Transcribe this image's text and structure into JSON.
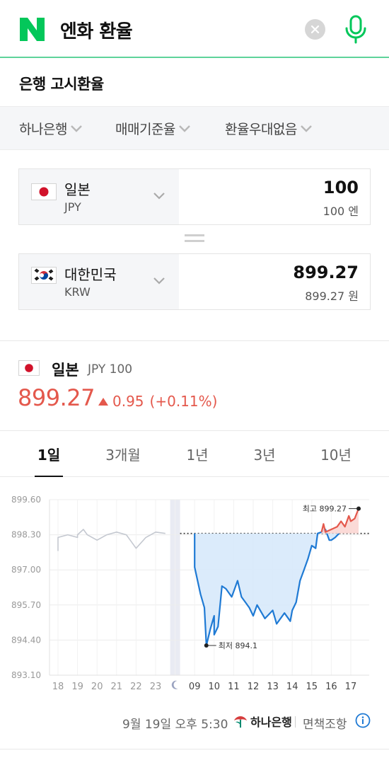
{
  "search": {
    "query": "엔화 환율",
    "logo_letter": "N",
    "logo_icon": "naver-logo-icon",
    "clear_icon": "clear-icon",
    "mic_icon": "microphone-icon",
    "accent_color": "#03c75a"
  },
  "section_title": "은행 고시환율",
  "filters": [
    {
      "label": "하나은행"
    },
    {
      "label": "매매기준율"
    },
    {
      "label": "환율우대없음"
    }
  ],
  "converter": {
    "from": {
      "name": "일본",
      "code": "JPY",
      "amount": "100",
      "amount_text": "100 엔",
      "flag_icon": "japan-flag-icon"
    },
    "to": {
      "name": "대한민국",
      "code": "KRW",
      "amount": "899.27",
      "amount_text": "899.27 원",
      "flag_icon": "korea-flag-icon"
    }
  },
  "rate": {
    "country": "일본",
    "code": "JPY 100",
    "value": "899.27",
    "change": "0.95",
    "change_pct": "(+0.11%)",
    "direction": "up",
    "up_color": "#e4584c"
  },
  "tabs": [
    {
      "label": "1일",
      "active": true
    },
    {
      "label": "3개월",
      "active": false
    },
    {
      "label": "1년",
      "active": false
    },
    {
      "label": "3년",
      "active": false
    },
    {
      "label": "10년",
      "active": false
    }
  ],
  "chart_data": {
    "type": "line",
    "y_ticks": [
      "899.60",
      "898.30",
      "897.00",
      "895.70",
      "894.40",
      "893.10"
    ],
    "ylim": [
      893.1,
      899.6
    ],
    "x_labels": [
      "18",
      "19",
      "20",
      "21",
      "22",
      "23",
      "moon-icon",
      "09",
      "10",
      "11",
      "12",
      "13",
      "14",
      "15",
      "16",
      "17"
    ],
    "grid": true,
    "baseline": 898.35,
    "max_label": "최고 899.27",
    "min_label": "최저 894.1",
    "series": [
      {
        "segment": "previous-days",
        "color": "#c4c8d0",
        "points": [
          [
            "18",
            897.7
          ],
          [
            "18",
            898.2
          ],
          [
            "18.5",
            898.3
          ],
          [
            "19",
            898.2
          ],
          [
            "19",
            898.3
          ],
          [
            "19.3",
            898.5
          ],
          [
            "19.5",
            898.3
          ],
          [
            "20",
            898.1
          ],
          [
            "20.5",
            898.3
          ],
          [
            "21",
            898.4
          ],
          [
            "21.5",
            898.3
          ],
          [
            "21.7",
            898.1
          ],
          [
            "22",
            897.8
          ],
          [
            "22.5",
            898.2
          ],
          [
            "23",
            898.4
          ],
          [
            "23.5",
            898.35
          ]
        ]
      },
      {
        "segment": "today-below-baseline",
        "color": "#1f7ad4",
        "points": [
          [
            "09",
            898.35
          ],
          [
            "09",
            897.3
          ],
          [
            "09",
            897.1
          ],
          [
            "09.3",
            896.1
          ],
          [
            "09.5",
            895.6
          ],
          [
            "09.6",
            894.2
          ],
          [
            "09.8",
            894.8
          ],
          [
            "10",
            895.3
          ],
          [
            "10",
            894.6
          ],
          [
            "10.2",
            894.9
          ],
          [
            "10.4",
            896.4
          ],
          [
            "10.6",
            896.3
          ],
          [
            "10.9",
            896.0
          ],
          [
            "11",
            896.2
          ],
          [
            "11.2",
            896.6
          ],
          [
            "11.4",
            896.0
          ],
          [
            "11.6",
            895.8
          ],
          [
            "11.8",
            895.6
          ],
          [
            "12",
            895.3
          ],
          [
            "12.2",
            895.7
          ],
          [
            "12.6",
            895.2
          ],
          [
            "13",
            895.5
          ],
          [
            "13.2",
            895.0
          ],
          [
            "13.6",
            895.4
          ],
          [
            "13.9",
            895.1
          ],
          [
            "14",
            895.5
          ],
          [
            "14.2",
            895.8
          ],
          [
            "14.4",
            896.6
          ],
          [
            "14.6",
            897.0
          ],
          [
            "14.8",
            897.4
          ],
          [
            "15",
            897.9
          ],
          [
            "15.2",
            897.8
          ],
          [
            "15.3",
            898.35
          ],
          [
            "15.5",
            898.4
          ],
          [
            "15.7",
            898.5
          ],
          [
            "15.9",
            898.1
          ],
          [
            "16",
            898.1
          ],
          [
            "16.2",
            898.2
          ],
          [
            "16.4",
            898.35
          ]
        ]
      },
      {
        "segment": "today-above-baseline",
        "color": "#e4584c",
        "points": [
          [
            "15.5",
            898.4
          ],
          [
            "15.6",
            898.7
          ],
          [
            "15.7",
            898.4
          ],
          [
            "16.3",
            898.6
          ],
          [
            "16.5",
            898.8
          ],
          [
            "16.7",
            898.6
          ],
          [
            "16.9",
            899.0
          ],
          [
            "17",
            898.8
          ],
          [
            "17.2",
            898.9
          ],
          [
            "17.4",
            899.27
          ]
        ]
      }
    ]
  },
  "footer": {
    "timestamp": "9월 19일 오후 5:30",
    "bank_name": "하나은행",
    "bank_icon": "hana-bank-logo-icon",
    "disclaimer": "면책조항",
    "info_icon": "info-icon"
  }
}
